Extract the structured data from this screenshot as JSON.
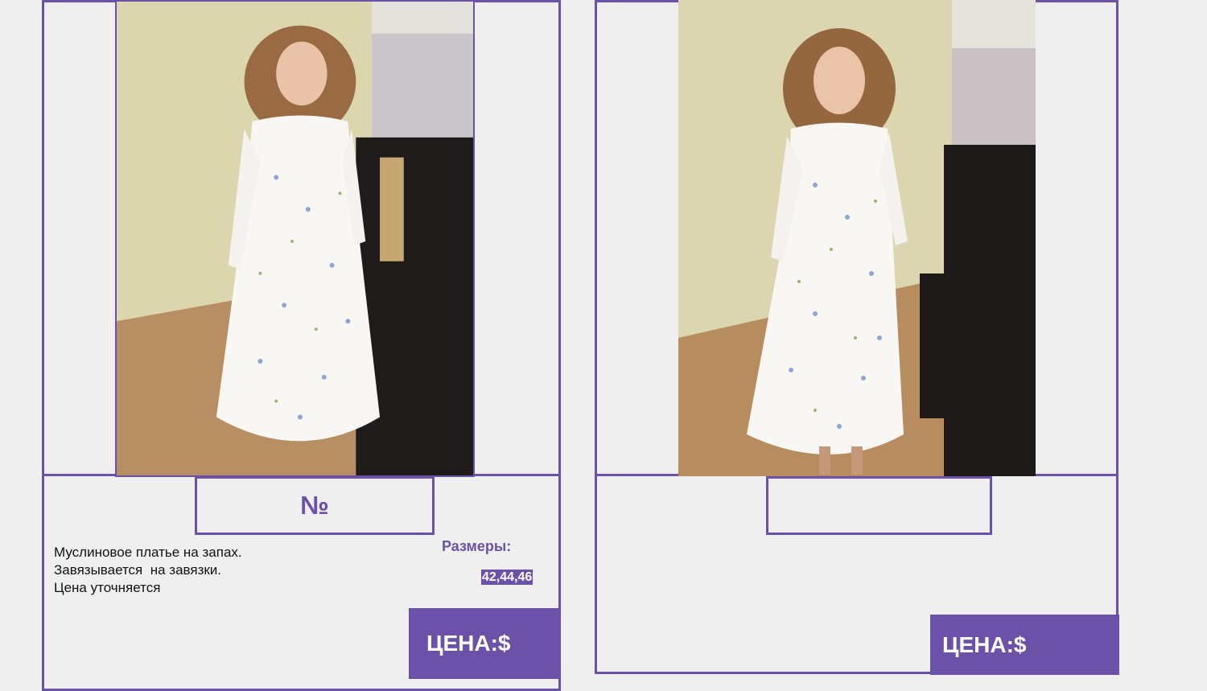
{
  "cards": [
    {
      "number_label": "№",
      "description": [
        "Муслиновое платье на запах.",
        "Завязывается  на завязки.",
        "Цена уточняется"
      ],
      "sizes_label": "Размеры:",
      "sizes_value": "42,44,46",
      "price_label": "ЦЕНА:$"
    },
    {
      "number_label": "",
      "price_label": "ЦЕНА:$"
    }
  ],
  "colors": {
    "accent": "#6b52a8",
    "background": "#efeff0"
  }
}
